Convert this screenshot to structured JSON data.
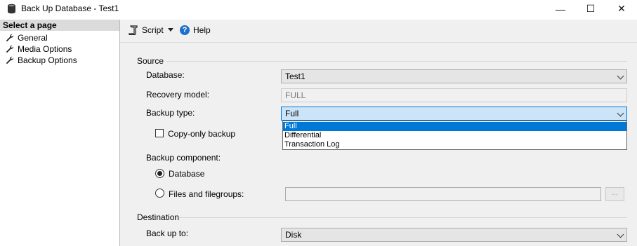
{
  "window": {
    "title": "Back Up Database - Test1",
    "minimize_glyph": "—",
    "maximize_glyph": "☐",
    "close_glyph": "✕"
  },
  "sidebar": {
    "header": "Select a page",
    "items": [
      {
        "label": "General",
        "icon": "wrench-icon"
      },
      {
        "label": "Media Options",
        "icon": "wrench-icon"
      },
      {
        "label": "Backup Options",
        "icon": "wrench-icon"
      }
    ]
  },
  "toolbar": {
    "script_label": "Script",
    "help_label": "Help",
    "help_glyph": "?"
  },
  "source": {
    "group_label": "Source",
    "database_label": "Database:",
    "database_value": "Test1",
    "recovery_label": "Recovery model:",
    "recovery_value": "FULL",
    "backup_type_label": "Backup type:",
    "backup_type_value": "Full",
    "backup_type_options": [
      "Full",
      "Differential",
      "Transaction Log"
    ],
    "copy_only_label": "Copy-only backup",
    "component_label": "Backup component:",
    "radio_database_label": "Database",
    "radio_files_label": "Files and filegroups:",
    "files_value": "",
    "ellipsis_label": "..."
  },
  "destination": {
    "group_label": "Destination",
    "backup_to_label": "Back up to:",
    "backup_to_value": "Disk"
  },
  "colors": {
    "selection": "#0078d7",
    "focus_fill": "#cce4f7",
    "panel": "#f0f0f0"
  }
}
